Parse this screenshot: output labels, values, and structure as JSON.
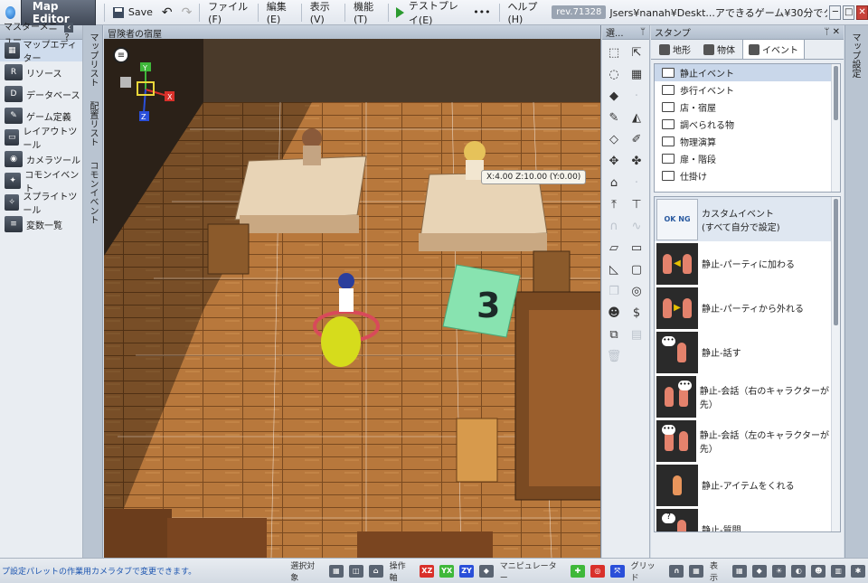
{
  "titlebar": {
    "app_name": "Map Editor",
    "save_label": "Save",
    "menus": [
      "ファイル(F)",
      "編集(E)",
      "表示(V)",
      "機能(T)"
    ],
    "test_play_label": "テストプレイ(E)",
    "more_label": "•••",
    "help_label": "ヘルプ(H)",
    "revision": "rev.71328",
    "path": "Jsers¥nanah¥Deskt...アできるゲーム¥30分でクリア出来るゲーム",
    "minimize": "─",
    "maximize": "□",
    "close": "✕"
  },
  "master_menu": {
    "title": "マスターメニュー",
    "collapse_icon": "‹",
    "help_icon": "?",
    "items": [
      {
        "label": "マップエディター",
        "icon": "map-editor-icon"
      },
      {
        "label": "リソース",
        "icon": "resource-icon"
      },
      {
        "label": "データベース",
        "icon": "database-icon"
      },
      {
        "label": "ゲーム定義",
        "icon": "game-definition-icon"
      },
      {
        "label": "レイアウトツール",
        "icon": "layout-tool-icon"
      },
      {
        "label": "カメラツール",
        "icon": "camera-tool-icon"
      },
      {
        "label": "コモンイベント",
        "icon": "common-event-icon"
      },
      {
        "label": "スプライトツール",
        "icon": "sprite-tool-icon"
      },
      {
        "label": "変数一覧",
        "icon": "variable-list-icon"
      }
    ]
  },
  "vertical_tabs": [
    "マップリスト",
    "配置リスト",
    "コモンイベント"
  ],
  "right_tab": "マップ設定",
  "viewport": {
    "map_name": "冒険者の宿屋",
    "coord_readout": "X:4.00 Z:10.00 (Y:0.00)",
    "axis_x": "X",
    "axis_y": "Y",
    "axis_z": "Z"
  },
  "tools_panel": {
    "title": "選...",
    "pin_icon": "ᛘ"
  },
  "stamp_panel": {
    "title": "スタンプ",
    "tabs": [
      "地形",
      "物体",
      "イベント"
    ],
    "folders": [
      "静止イベント",
      "歩行イベント",
      "店・宿屋",
      "調べられる物",
      "物理演算",
      "扉・階段",
      "仕掛け"
    ],
    "events": [
      {
        "label": "カスタムイベント\n(すべて自分で設定)"
      },
      {
        "label": "静止-パーティに加わる"
      },
      {
        "label": "静止-パーティから外れる"
      },
      {
        "label": "静止-話す"
      },
      {
        "label": "静止-会話（右のキャラクターが先）"
      },
      {
        "label": "静止-会話（左のキャラクターが先）"
      },
      {
        "label": "静止-アイテムをくれる"
      },
      {
        "label": "静止-質問"
      }
    ]
  },
  "statusbar": {
    "message": "プ設定パレットの作業用カメラタブで変更できます。",
    "select_target": "選択対象",
    "operation_axis": "操作軸",
    "axis_xz": "XZ",
    "axis_yx": "YX",
    "axis_zy": "ZY",
    "manipulator": "マニピュレーター",
    "grid": "グリッド",
    "display": "表示"
  },
  "colors": {
    "accent": "#2b9a2f",
    "close": "#c8423a",
    "floor": "#b97a3e",
    "axis_red": "#d9302a",
    "axis_green": "#3fb83a",
    "axis_blue": "#2a4fd9"
  }
}
